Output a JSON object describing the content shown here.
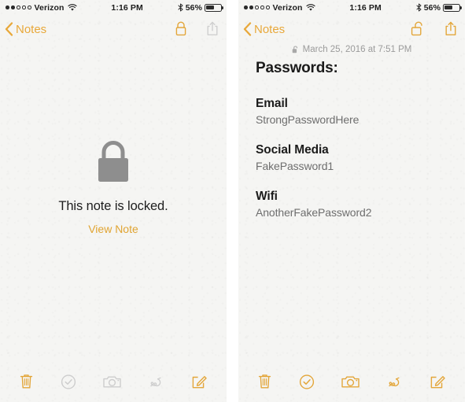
{
  "colors": {
    "accent": "#e3a63a",
    "accent_dim": "#eec98a",
    "inactive": "#c9c9c9",
    "lock_gray": "#8e8e8e",
    "text": "#1b1b1b",
    "subtext": "#6e6e6e",
    "date_gray": "#9b9b9b",
    "paper": "#f5f5f3"
  },
  "panels": [
    {
      "id": "locked-note",
      "status_bar": {
        "carrier": "Verizon",
        "signal_dots_filled": 2,
        "signal_dots_total": 5,
        "wifi_icon": "wifi-icon",
        "time": "1:16 PM",
        "bluetooth_icon": "bluetooth-icon",
        "battery_percent": "56%",
        "battery_level": 56
      },
      "nav": {
        "back_icon": "chevron-left-icon",
        "back_label": "Notes",
        "lock_icon": "lock-closed-icon",
        "lock_state": "locked",
        "lock_active": true,
        "share_icon": "share-icon",
        "share_active": false
      },
      "locked_state": {
        "lock_icon": "lock-closed-large-icon",
        "message": "This note is locked.",
        "action_label": "View Note"
      },
      "toolbar": [
        {
          "name": "trash-icon",
          "label": "Delete",
          "active": true
        },
        {
          "name": "checklist-circle-icon",
          "label": "Checklist",
          "active": false
        },
        {
          "name": "camera-icon",
          "label": "Camera",
          "active": false
        },
        {
          "name": "scribble-icon",
          "label": "Sketch",
          "active": false
        },
        {
          "name": "compose-icon",
          "label": "New Note",
          "active": true
        }
      ]
    },
    {
      "id": "unlocked-note",
      "status_bar": {
        "carrier": "Verizon",
        "signal_dots_filled": 2,
        "signal_dots_total": 5,
        "wifi_icon": "wifi-icon",
        "time": "1:16 PM",
        "bluetooth_icon": "bluetooth-icon",
        "battery_percent": "56%",
        "battery_level": 56
      },
      "nav": {
        "back_icon": "chevron-left-icon",
        "back_label": "Notes",
        "lock_icon": "lock-open-icon",
        "lock_state": "unlocked",
        "lock_active": true,
        "share_icon": "share-icon",
        "share_active": true
      },
      "note": {
        "date_lock_icon": "lock-open-small-icon",
        "date": "March 25, 2016 at 7:51 PM",
        "title": "Passwords:",
        "entries": [
          {
            "label": "Email",
            "value": "StrongPasswordHere"
          },
          {
            "label": "Social Media",
            "value": "FakePassword1"
          },
          {
            "label": "Wifi",
            "value": "AnotherFakePassword2"
          }
        ]
      },
      "toolbar": [
        {
          "name": "trash-icon",
          "label": "Delete",
          "active": true
        },
        {
          "name": "checklist-circle-icon",
          "label": "Checklist",
          "active": true
        },
        {
          "name": "camera-icon",
          "label": "Camera",
          "active": true
        },
        {
          "name": "scribble-icon",
          "label": "Sketch",
          "active": true
        },
        {
          "name": "compose-icon",
          "label": "New Note",
          "active": true
        }
      ]
    }
  ]
}
